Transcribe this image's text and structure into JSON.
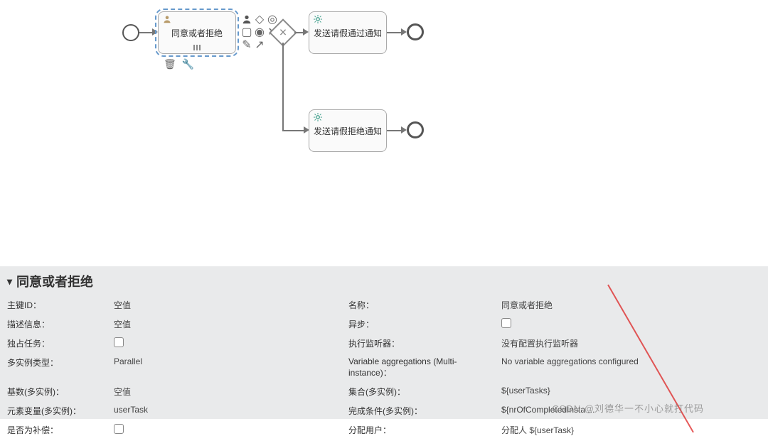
{
  "diagram": {
    "userTask": {
      "label": "同意或者拒绝"
    },
    "serviceTask1": {
      "label": "发送请假通过通知"
    },
    "serviceTask2": {
      "label": "发送请假拒绝通知"
    }
  },
  "panel": {
    "title": "同意或者拒绝",
    "rows": [
      {
        "l1": "主键ID：",
        "v1": "空值",
        "l2": "名称：",
        "v2": "同意或者拒绝"
      },
      {
        "l1": "描述信息：",
        "v1": "空值",
        "l2": "异步：",
        "v2": "__checkbox__"
      },
      {
        "l1": "独占任务：",
        "v1": "__checkbox__",
        "l2": "执行监听器：",
        "v2": "没有配置执行监听器"
      },
      {
        "l1": "多实例类型：",
        "v1": "Parallel",
        "l2": "Variable aggregations (Multi-instance)：",
        "v2": "No variable aggregations configured"
      },
      {
        "l1": "基数(多实例)：",
        "v1": "空值",
        "l2": "集合(多实例)：",
        "v2": "${userTasks}"
      },
      {
        "l1": "元素变量(多实例)：",
        "v1": "userTask",
        "l2": "完成条件(多实例)：",
        "v2": "${nrOfCompletedInsta ..."
      },
      {
        "l1": "是否为补偿：",
        "v1": "__checkbox__",
        "l2": "分配用户：",
        "v2": "分配人 ${userTask}"
      }
    ]
  },
  "watermark": "CSDN @刘德华一不小心就打代码"
}
